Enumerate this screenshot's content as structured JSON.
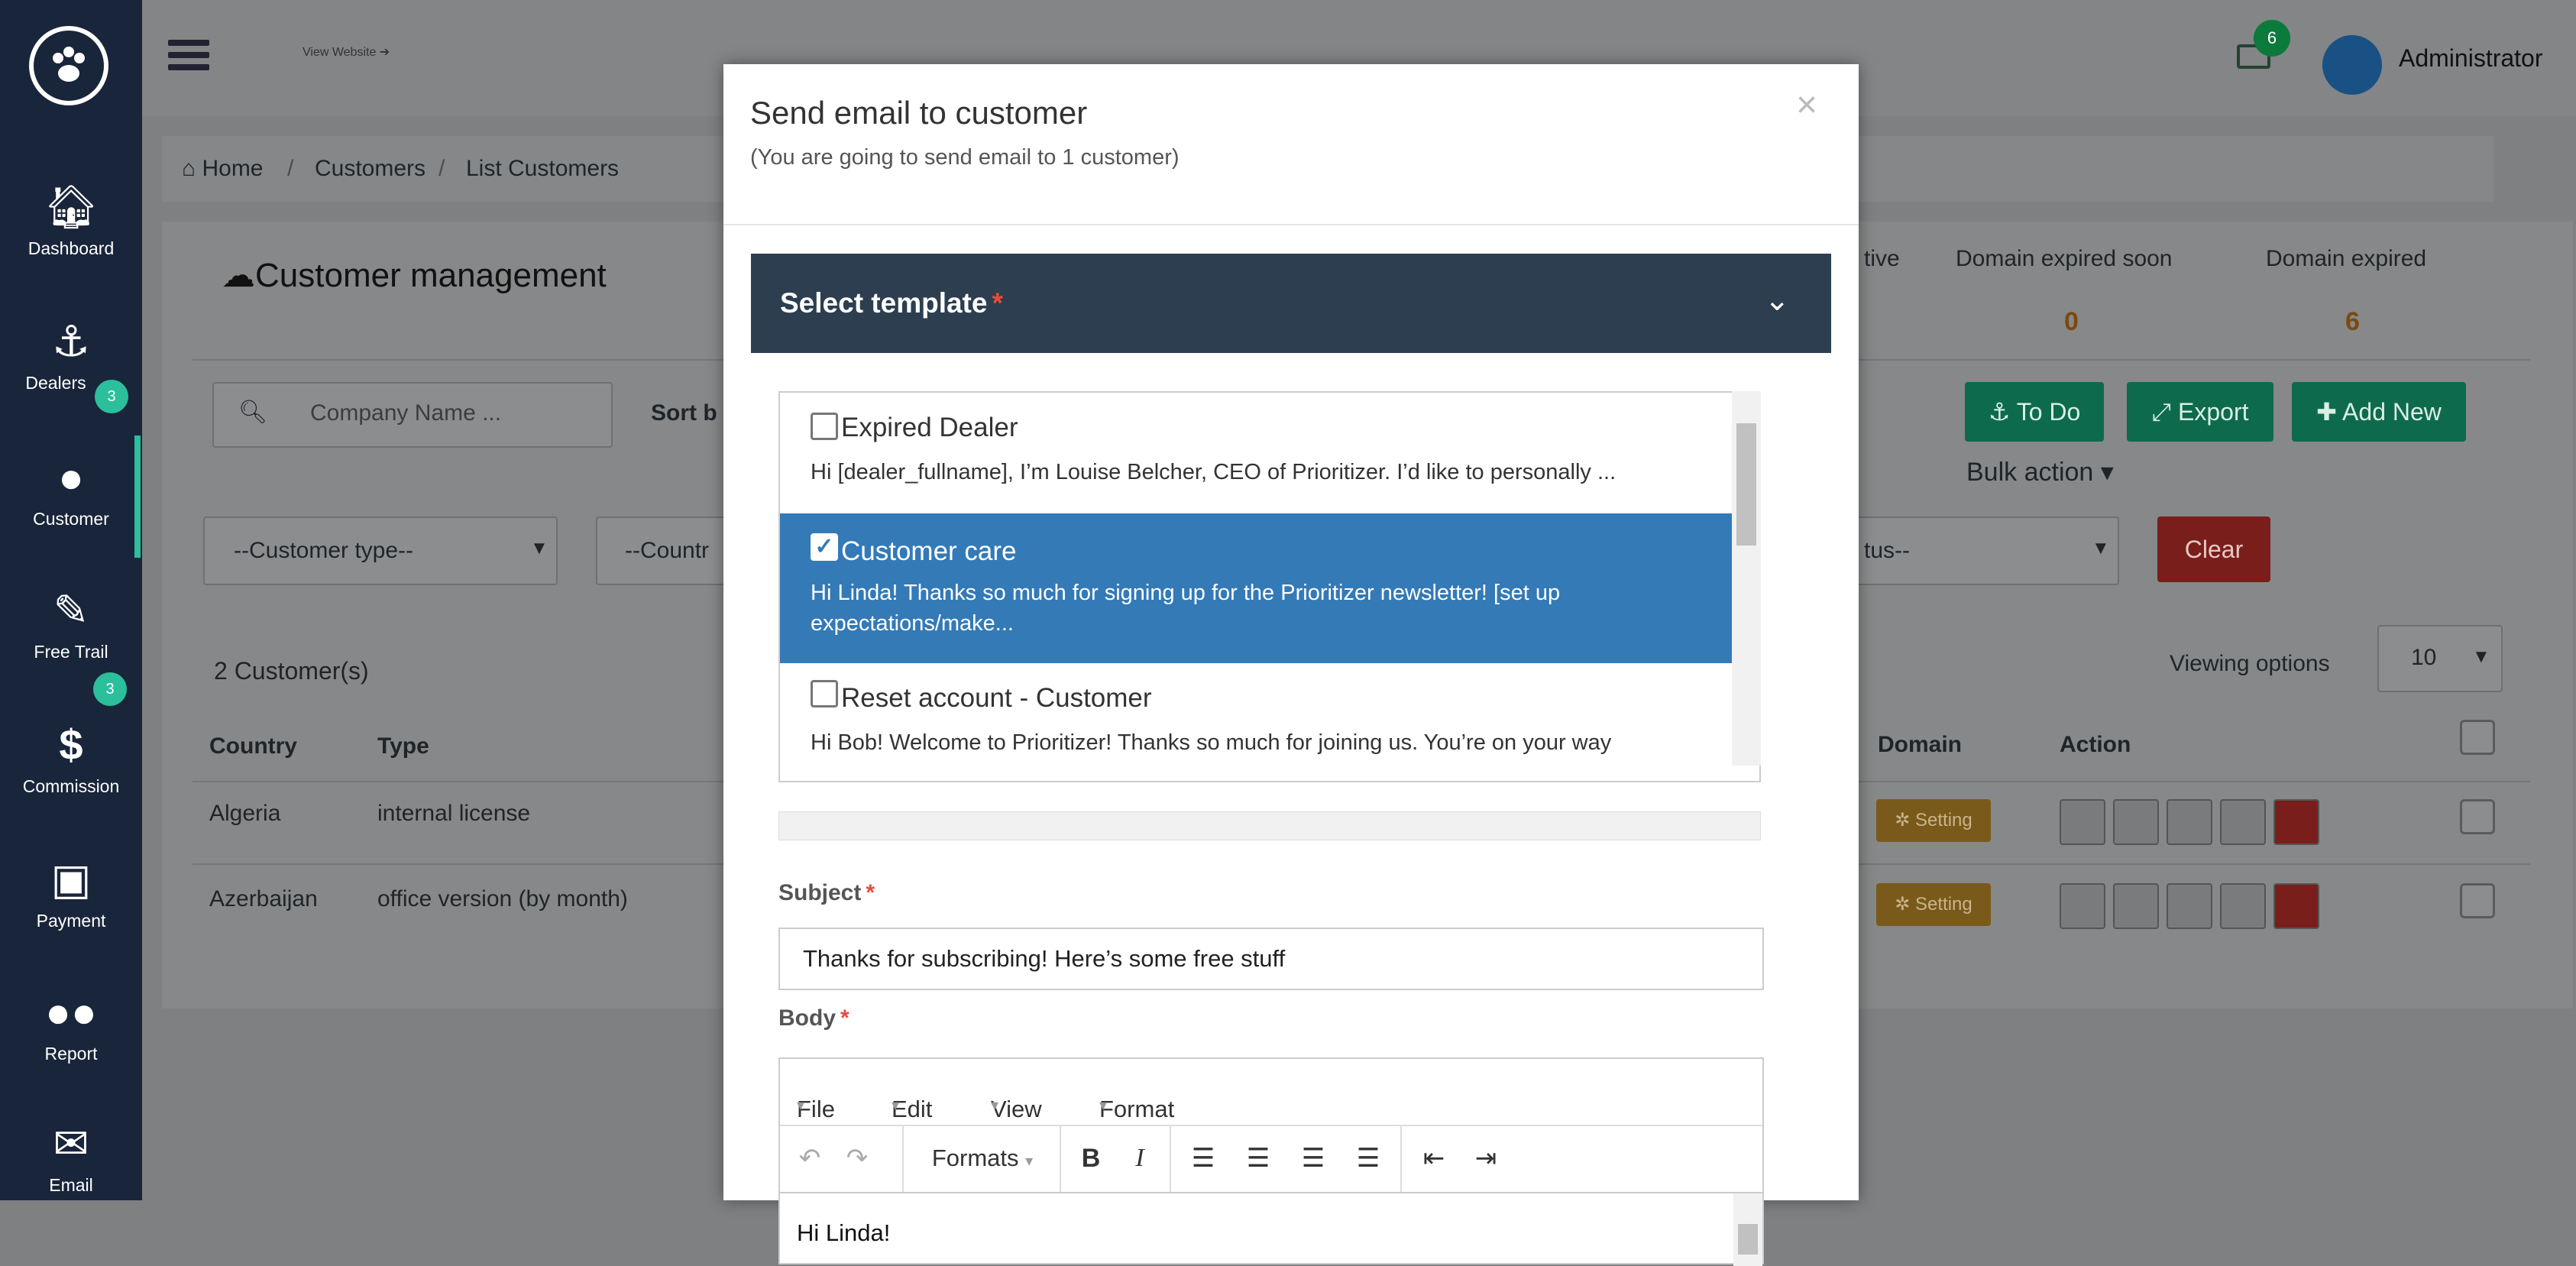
{
  "sidebar": {
    "items": [
      {
        "label": "Dashboard",
        "icon": "home-icon"
      },
      {
        "label": "Dealers",
        "icon": "anchor-icon",
        "badge": "3"
      },
      {
        "label": "Customer",
        "icon": "user-icon"
      },
      {
        "label": "Free Trail",
        "icon": "edit-icon",
        "badge": "3"
      },
      {
        "label": "Commission",
        "icon": "dollar-icon"
      },
      {
        "label": "Payment",
        "icon": "money-icon"
      },
      {
        "label": "Report",
        "icon": "users-icon"
      },
      {
        "label": "Email",
        "icon": "envelope-icon"
      }
    ]
  },
  "topbar": {
    "view_website": "View Website ➔",
    "mail_count": "6",
    "user_name": "Administrator"
  },
  "breadcrumb": {
    "home": "Home",
    "customers": "Customers",
    "list": "List Customers"
  },
  "main": {
    "title": "Customer management",
    "stats": [
      {
        "label": "tive",
        "value": ""
      },
      {
        "label": "Domain expired soon",
        "value": "0"
      },
      {
        "label": "Domain expired",
        "value": "6"
      }
    ],
    "search_placeholder": "Company Name ...",
    "sort_label": "Sort b",
    "buttons": {
      "todo": "To Do",
      "export": "Export",
      "add_new": "Add New",
      "bulk": "Bulk action",
      "clear": "Clear"
    },
    "filters": {
      "customer_type": "--Customer type--",
      "country": "--Countr",
      "status": "tus--"
    },
    "count_text": "2 Customer(s)",
    "viewing_options": "Viewing options",
    "page_size": "10",
    "columns": {
      "country": "Country",
      "type": "Type",
      "domain": "Domain",
      "action": "Action"
    },
    "rows": [
      {
        "country": "Algeria",
        "type": "internal license",
        "domain": "Setting"
      },
      {
        "country": "Azerbaijan",
        "type": "office version (by month)",
        "domain": "Setting"
      }
    ]
  },
  "modal": {
    "title": "Send email to customer",
    "subtitle": "(You are going to send email to 1 customer)",
    "close": "×",
    "template_label": "Select template",
    "required_mark": "*",
    "templates": [
      {
        "name": "Expired Dealer",
        "desc": "Hi [dealer_fullname], I’m Louise Belcher, CEO of Prioritizer. I’d like to personally ...",
        "checked": false
      },
      {
        "name": "Customer care",
        "desc": "Hi Linda! Thanks so much for signing up for the Prioritizer newsletter! [set up expectations/make...",
        "checked": true
      },
      {
        "name": "Reset account - Customer",
        "desc": "Hi Bob! Welcome to Prioritizer! Thanks so much for joining us. You’re on your way",
        "checked": false
      }
    ],
    "subject_label": "Subject",
    "subject_value": "Thanks for subscribing! Here’s some free stuff",
    "body_label": "Body",
    "editor": {
      "menu": [
        "File",
        "Edit",
        "View",
        "Format"
      ],
      "formats_label": "Formats",
      "body_text": "Hi Linda!"
    }
  }
}
